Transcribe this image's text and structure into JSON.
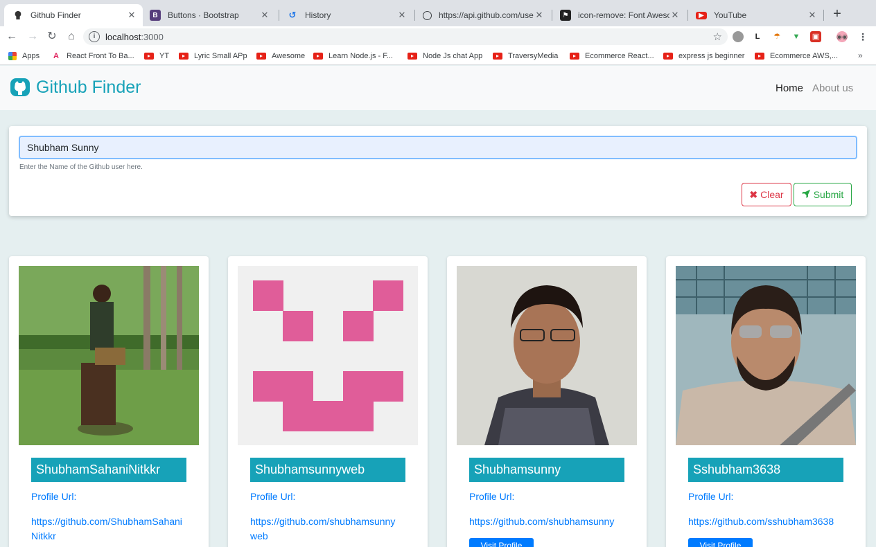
{
  "browser": {
    "tabs": [
      {
        "title": "Github Finder",
        "active": true
      },
      {
        "title": "Buttons · Bootstrap",
        "active": false
      },
      {
        "title": "History",
        "active": false
      },
      {
        "title": "https://api.github.com/users",
        "active": false
      },
      {
        "title": "icon-remove: Font Awesome",
        "active": false
      },
      {
        "title": "YouTube",
        "active": false
      }
    ],
    "url_host": "localhost",
    "url_port": ":3000",
    "bookmarks": [
      "Apps",
      "React Front To Ba...",
      "YT",
      "Lyric Small APp",
      "Awesome",
      "Learn Node.js - F...",
      "Node Js chat App",
      "TraversyMedia",
      "Ecommerce React...",
      "express js beginner",
      "Ecommerce AWS,..."
    ],
    "ext_letter": "L"
  },
  "app": {
    "brand": "Github Finder",
    "nav": {
      "home": "Home",
      "about": "About us"
    },
    "search": {
      "value": "Shubham Sunny",
      "help": "Enter the Name of the Github user here.",
      "clear_label": "Clear",
      "submit_label": "Submit"
    },
    "profile_label": "Profile Url:",
    "visit_label": "Visit Profile",
    "users": [
      {
        "login": "ShubhamSahaniNitkkr",
        "url": "https://github.com/ShubhamSahaniNitkkr",
        "url_line1": "https://github.com/ShubhamSahani",
        "url_line2": "Nitkkr"
      },
      {
        "login": "Shubhamsunnyweb",
        "url": "https://github.com/shubhamsunnyweb",
        "url_line1": "https://github.com/shubhamsunny",
        "url_line2": "web"
      },
      {
        "login": "Shubhamsunny",
        "url": "https://github.com/shubhamsunny",
        "url_line1": "https://github.com/shubhamsunny",
        "url_line2": ""
      },
      {
        "login": "Sshubham3638",
        "url": "https://github.com/sshubham3638",
        "url_line1": "https://github.com/sshubham3638",
        "url_line2": ""
      }
    ]
  },
  "colors": {
    "brand": "#17a2b8",
    "danger": "#dc3545",
    "success": "#28a745",
    "primary": "#007bff",
    "identicon": "#e05d99"
  }
}
